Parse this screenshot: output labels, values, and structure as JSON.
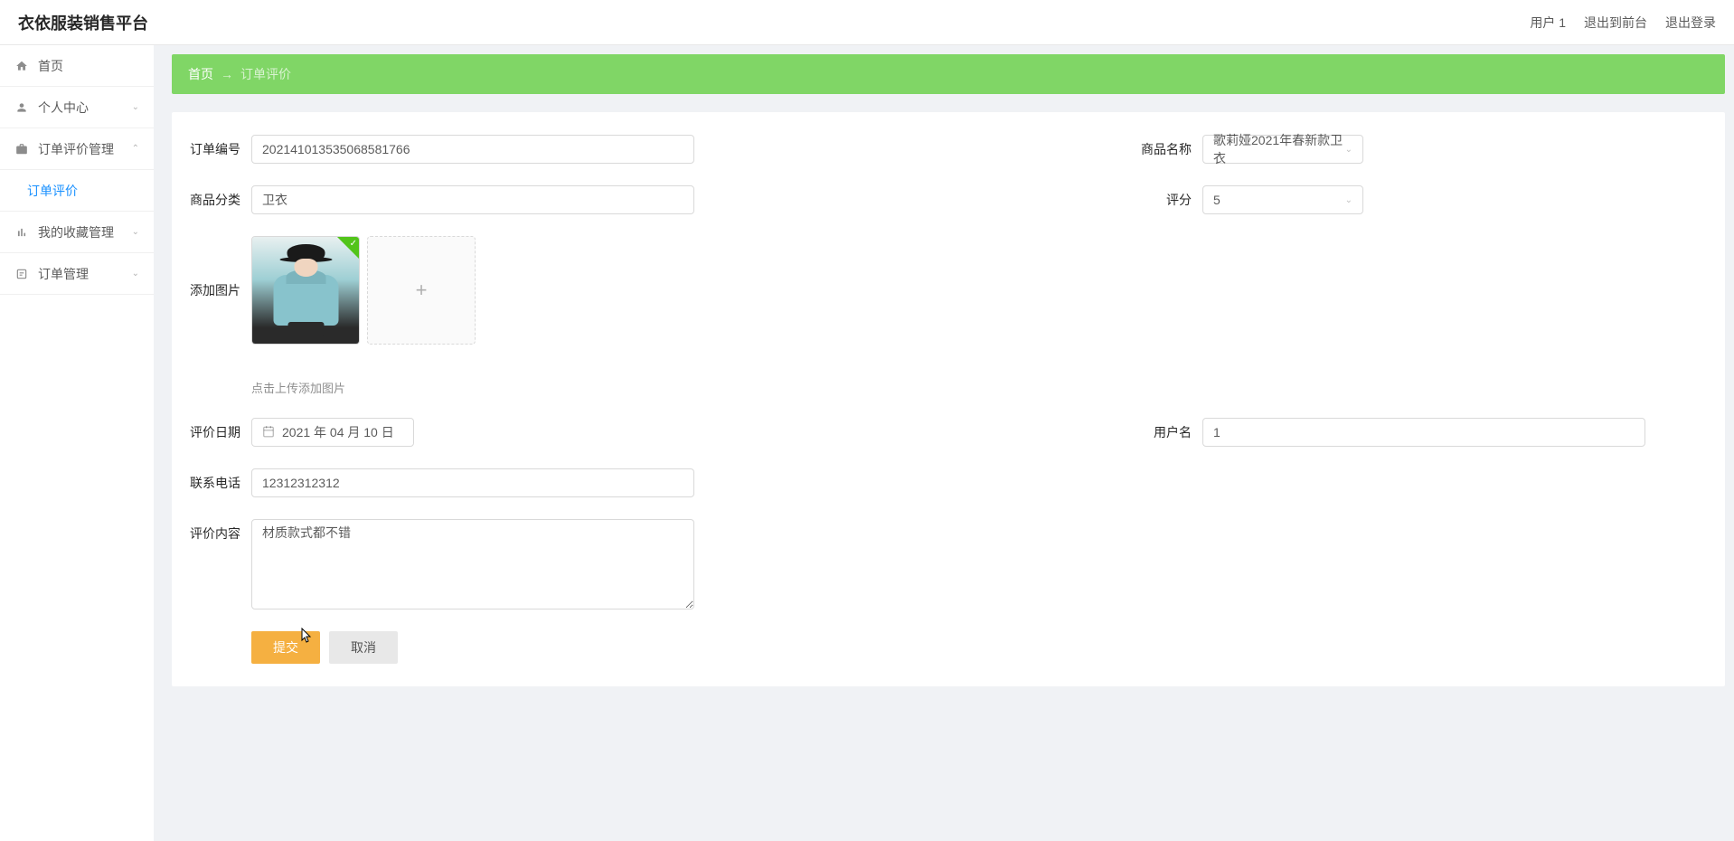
{
  "header": {
    "title": "衣依服装销售平台",
    "user": "用户 1",
    "back_front": "退出到前台",
    "logout": "退出登录"
  },
  "sidebar": {
    "home": "首页",
    "personal": "个人中心",
    "order_review_mgmt": "订单评价管理",
    "order_review": "订单评价",
    "collection_mgmt": "我的收藏管理",
    "order_mgmt": "订单管理"
  },
  "breadcrumb": {
    "home": "首页",
    "current": "订单评价"
  },
  "form": {
    "order_no_label": "订单编号",
    "order_no_value": "2021410135350685817​66",
    "product_name_label": "商品名称",
    "product_name_value": "歌莉娅2021年春新款卫衣",
    "category_label": "商品分类",
    "category_value": "卫衣",
    "rating_label": "评分",
    "rating_value": "5",
    "add_image_label": "添加图片",
    "upload_hint": "点击上传添加图片",
    "review_date_label": "评价日期",
    "review_date_value": "2021 年 04 月 10 日",
    "username_label": "用户名",
    "username_value": "1",
    "phone_label": "联系电话",
    "phone_value": "12312312312",
    "content_label": "评价内容",
    "content_value": "材质款式都不错",
    "submit": "提交",
    "cancel": "取消"
  }
}
